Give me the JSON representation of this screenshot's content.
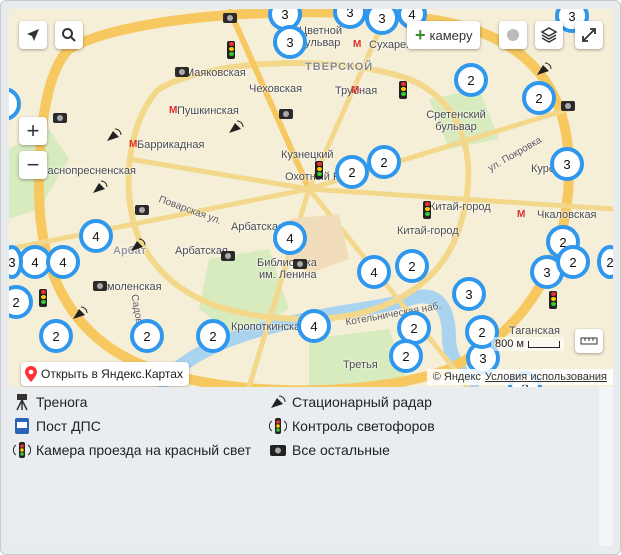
{
  "map": {
    "places": [
      {
        "name": "Маяковская"
      },
      {
        "name": "Чеховская"
      },
      {
        "name": "Тверской"
      },
      {
        "name": "Трубная"
      },
      {
        "name": "Пушкинская"
      },
      {
        "name": "Сретенский бульвар"
      },
      {
        "name": "Баррикадная"
      },
      {
        "name": "Кузнецкий"
      },
      {
        "name": "Краснопресненская"
      },
      {
        "name": "Охотный Ряд"
      },
      {
        "name": "Китай-город"
      },
      {
        "name": "Китай-город"
      },
      {
        "name": "Курская"
      },
      {
        "name": "Чкаловская"
      },
      {
        "name": "Арбатская"
      },
      {
        "name": "Арбатская"
      },
      {
        "name": "Библиотека"
      },
      {
        "name": "им. Ленина"
      },
      {
        "name": "Смоленская"
      },
      {
        "name": "Арбат"
      },
      {
        "name": "Таганская"
      },
      {
        "name": "Третья"
      },
      {
        "name": "Кропоткинская"
      },
      {
        "name": "Сухаревская"
      },
      {
        "name": "Цветной бульвар"
      }
    ],
    "streets": [
      {
        "name": "ул. Покровка"
      },
      {
        "name": "Поварская ул."
      },
      {
        "name": "Садовое"
      },
      {
        "name": "Котельническая наб."
      }
    ],
    "clusters": [
      "3",
      "3",
      "3",
      "3",
      "4",
      "3",
      "2",
      "2",
      "2",
      "2",
      "2",
      "3",
      "4",
      "4",
      "4",
      "4",
      "2",
      "4",
      "3",
      "2",
      "2",
      "3",
      "2",
      "2",
      "4",
      "2",
      "2",
      "3",
      "2",
      "2",
      "2",
      "3",
      "2",
      "2"
    ],
    "scale_label": "800 м",
    "open_label": "Открыть в Яндекс.Картах",
    "copyright": "© Яндекс",
    "terms": "Условия использования",
    "add_camera_label": "камеру"
  },
  "legend": {
    "tripod": "Тренога",
    "dps": "Пост ДПС",
    "red_light": "Камера проезда на красный свет",
    "radar": "Стационарный радар",
    "traffic_control": "Контроль светофоров",
    "others": "Все остальные"
  },
  "colors": {
    "cluster": "#2f97ee",
    "metro": "#d9302c",
    "park": "#cfe6b4",
    "road": "#f9d77e"
  }
}
